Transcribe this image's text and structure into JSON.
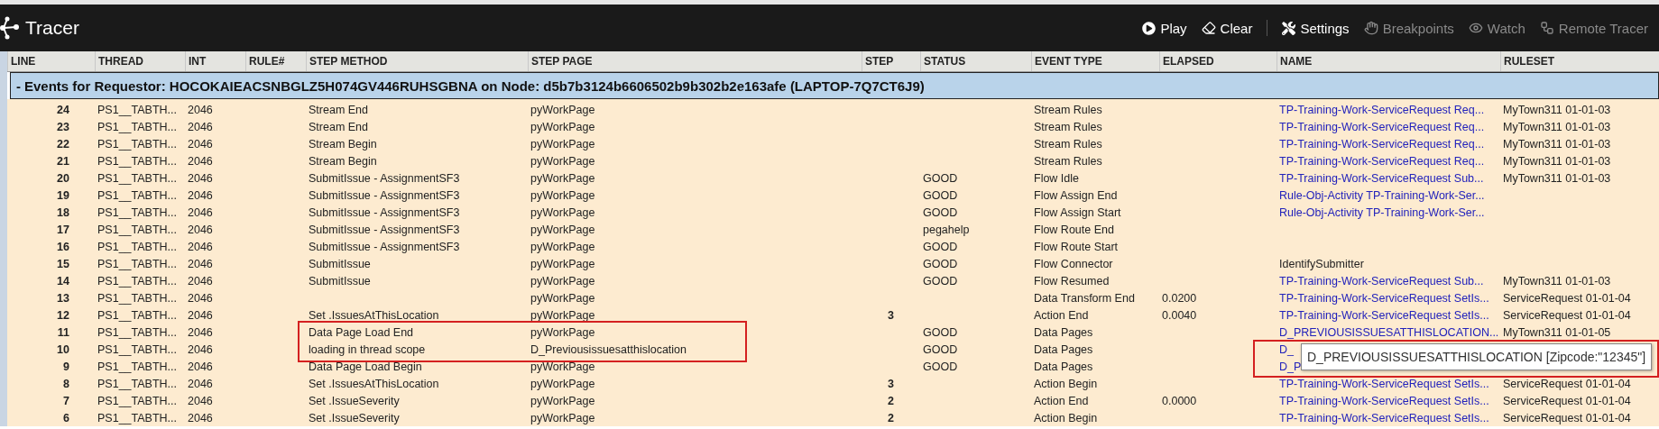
{
  "app": {
    "title": "Tracer"
  },
  "toolbar": [
    {
      "label": "Play",
      "disabled": false
    },
    {
      "label": "Clear",
      "disabled": false,
      "separator_after": true
    },
    {
      "label": "Settings",
      "disabled": false
    },
    {
      "label": "Breakpoints",
      "disabled": true
    },
    {
      "label": "Watch",
      "disabled": true
    },
    {
      "label": "Remote Tracer",
      "disabled": true
    }
  ],
  "table": {
    "columns": [
      "LINE",
      "THREAD",
      "INT",
      "RULE#",
      "STEP METHOD",
      "STEP PAGE",
      "STEP",
      "STATUS",
      "EVENT TYPE",
      "ELAPSED",
      "NAME",
      "RULESET"
    ],
    "group": {
      "toggle": "-",
      "title": "Events for Requestor: HOCOKAIEACSNBGLZ5H074GV446RUHSGBNA on Node: d5b7b3124b6606502b9b302b2e163afe (LAPTOP-7Q7CT6J9)"
    },
    "rows": [
      {
        "line": "24",
        "thread": "PS1__TABTH...",
        "int": "2046",
        "step_method": "Stream End",
        "step_page": "pyWorkPage",
        "event_type": "Stream Rules",
        "name": {
          "text": "TP-Training-Work-ServiceRequest Req...",
          "kind": "link"
        },
        "ruleset": "MyTown311 01-01-03"
      },
      {
        "line": "23",
        "thread": "PS1__TABTH...",
        "int": "2046",
        "step_method": "Stream End",
        "step_page": "pyWorkPage",
        "event_type": "Stream Rules",
        "name": {
          "text": "TP-Training-Work-ServiceRequest Req...",
          "kind": "link"
        },
        "ruleset": "MyTown311 01-01-03"
      },
      {
        "line": "22",
        "thread": "PS1__TABTH...",
        "int": "2046",
        "step_method": "Stream Begin",
        "step_page": "pyWorkPage",
        "event_type": "Stream Rules",
        "name": {
          "text": "TP-Training-Work-ServiceRequest Req...",
          "kind": "link"
        },
        "ruleset": "MyTown311 01-01-03"
      },
      {
        "line": "21",
        "thread": "PS1__TABTH...",
        "int": "2046",
        "step_method": "Stream Begin",
        "step_page": "pyWorkPage",
        "event_type": "Stream Rules",
        "name": {
          "text": "TP-Training-Work-ServiceRequest Req...",
          "kind": "link"
        },
        "ruleset": "MyTown311 01-01-03"
      },
      {
        "line": "20",
        "thread": "PS1__TABTH...",
        "int": "2046",
        "step_method": "SubmitIssue - AssignmentSF3",
        "step_page": "pyWorkPage",
        "status": "GOOD",
        "event_type": "Flow Idle",
        "name": {
          "text": "TP-Training-Work-ServiceRequest Sub...",
          "kind": "link"
        },
        "ruleset": "MyTown311 01-01-03"
      },
      {
        "line": "19",
        "thread": "PS1__TABTH...",
        "int": "2046",
        "step_method": "SubmitIssue - AssignmentSF3",
        "step_page": "pyWorkPage",
        "status": "GOOD",
        "event_type": "Flow Assign End",
        "name": {
          "text": "Rule-Obj-Activity TP-Training-Work-Ser...",
          "kind": "link"
        }
      },
      {
        "line": "18",
        "thread": "PS1__TABTH...",
        "int": "2046",
        "step_method": "SubmitIssue - AssignmentSF3",
        "step_page": "pyWorkPage",
        "status": "GOOD",
        "event_type": "Flow Assign Start",
        "name": {
          "text": "Rule-Obj-Activity TP-Training-Work-Ser...",
          "kind": "link"
        }
      },
      {
        "line": "17",
        "thread": "PS1__TABTH...",
        "int": "2046",
        "step_method": "SubmitIssue - AssignmentSF3",
        "step_page": "pyWorkPage",
        "status": "pegahelp",
        "event_type": "Flow Route End"
      },
      {
        "line": "16",
        "thread": "PS1__TABTH...",
        "int": "2046",
        "step_method": "SubmitIssue - AssignmentSF3",
        "step_page": "pyWorkPage",
        "status": "GOOD",
        "event_type": "Flow Route Start"
      },
      {
        "line": "15",
        "thread": "PS1__TABTH...",
        "int": "2046",
        "step_method": "SubmitIssue",
        "step_page": "pyWorkPage",
        "status": "GOOD",
        "event_type": "Flow Connector",
        "name": {
          "text": "IdentifySubmitter",
          "kind": "text"
        }
      },
      {
        "line": "14",
        "thread": "PS1__TABTH...",
        "int": "2046",
        "step_method": "SubmitIssue",
        "step_page": "pyWorkPage",
        "status": "GOOD",
        "event_type": "Flow Resumed",
        "name": {
          "text": "TP-Training-Work-ServiceRequest Sub...",
          "kind": "link"
        },
        "ruleset": "MyTown311 01-01-03"
      },
      {
        "line": "13",
        "thread": "PS1__TABTH...",
        "int": "2046",
        "step_page": "pyWorkPage",
        "event_type": "Data Transform End",
        "elapsed": "0.0200",
        "name": {
          "text": "TP-Training-Work-ServiceRequest SetIs...",
          "kind": "link"
        },
        "ruleset": "ServiceRequest 01-01-04"
      },
      {
        "line": "12",
        "thread": "PS1__TABTH...",
        "int": "2046",
        "step_method": "Set .IssuesAtThisLocation",
        "step_page": "pyWorkPage",
        "step": "3",
        "event_type": "Action End",
        "elapsed": "0.0040",
        "name": {
          "text": "TP-Training-Work-ServiceRequest SetIs...",
          "kind": "link"
        },
        "ruleset": "ServiceRequest 01-01-04"
      },
      {
        "line": "11",
        "thread": "PS1__TABTH...",
        "int": "2046",
        "step_method": "Data Page Load End",
        "step_page": "pyWorkPage",
        "status": "GOOD",
        "event_type": "Data Pages",
        "name": {
          "text": "D_PREVIOUSISSUESATTHISLOCATION...",
          "kind": "link"
        },
        "ruleset": "MyTown311 01-01-05"
      },
      {
        "line": "10",
        "thread": "PS1__TABTH...",
        "int": "2046",
        "step_method": "loading in thread scope",
        "step_page": "D_Previousissuesatthislocation",
        "status": "GOOD",
        "event_type": "Data Pages",
        "name": {
          "text": "D_",
          "kind": "link"
        }
      },
      {
        "line": "9",
        "thread": "PS1__TABTH...",
        "int": "2046",
        "step_method": "Data Page Load Begin",
        "step_page": "pyWorkPage",
        "status": "GOOD",
        "event_type": "Data Pages",
        "name": {
          "text": "D_P",
          "kind": "link"
        }
      },
      {
        "line": "8",
        "thread": "PS1__TABTH...",
        "int": "2046",
        "step_method": "Set .IssuesAtThisLocation",
        "step_page": "pyWorkPage",
        "step": "3",
        "event_type": "Action Begin",
        "name": {
          "text": "TP-Training-Work-ServiceRequest SetIs...",
          "kind": "link"
        },
        "ruleset": "ServiceRequest 01-01-04"
      },
      {
        "line": "7",
        "thread": "PS1__TABTH...",
        "int": "2046",
        "step_method": "Set .IssueSeverity",
        "step_page": "pyWorkPage",
        "step": "2",
        "event_type": "Action End",
        "elapsed": "0.0000",
        "name": {
          "text": "TP-Training-Work-ServiceRequest SetIs...",
          "kind": "link"
        },
        "ruleset": "ServiceRequest 01-01-04"
      },
      {
        "line": "6",
        "thread": "PS1__TABTH...",
        "int": "2046",
        "step_method": "Set .IssueSeverity",
        "step_page": "pyWorkPage",
        "step": "2",
        "event_type": "Action Begin",
        "name": {
          "text": "TP-Training-Work-ServiceRequest SetIs...",
          "kind": "link"
        },
        "ruleset": "ServiceRequest 01-01-04"
      }
    ]
  },
  "tooltip": {
    "text": "D_PREVIOUSISSUESATTHISLOCATION [Zipcode:\"12345\"]"
  }
}
